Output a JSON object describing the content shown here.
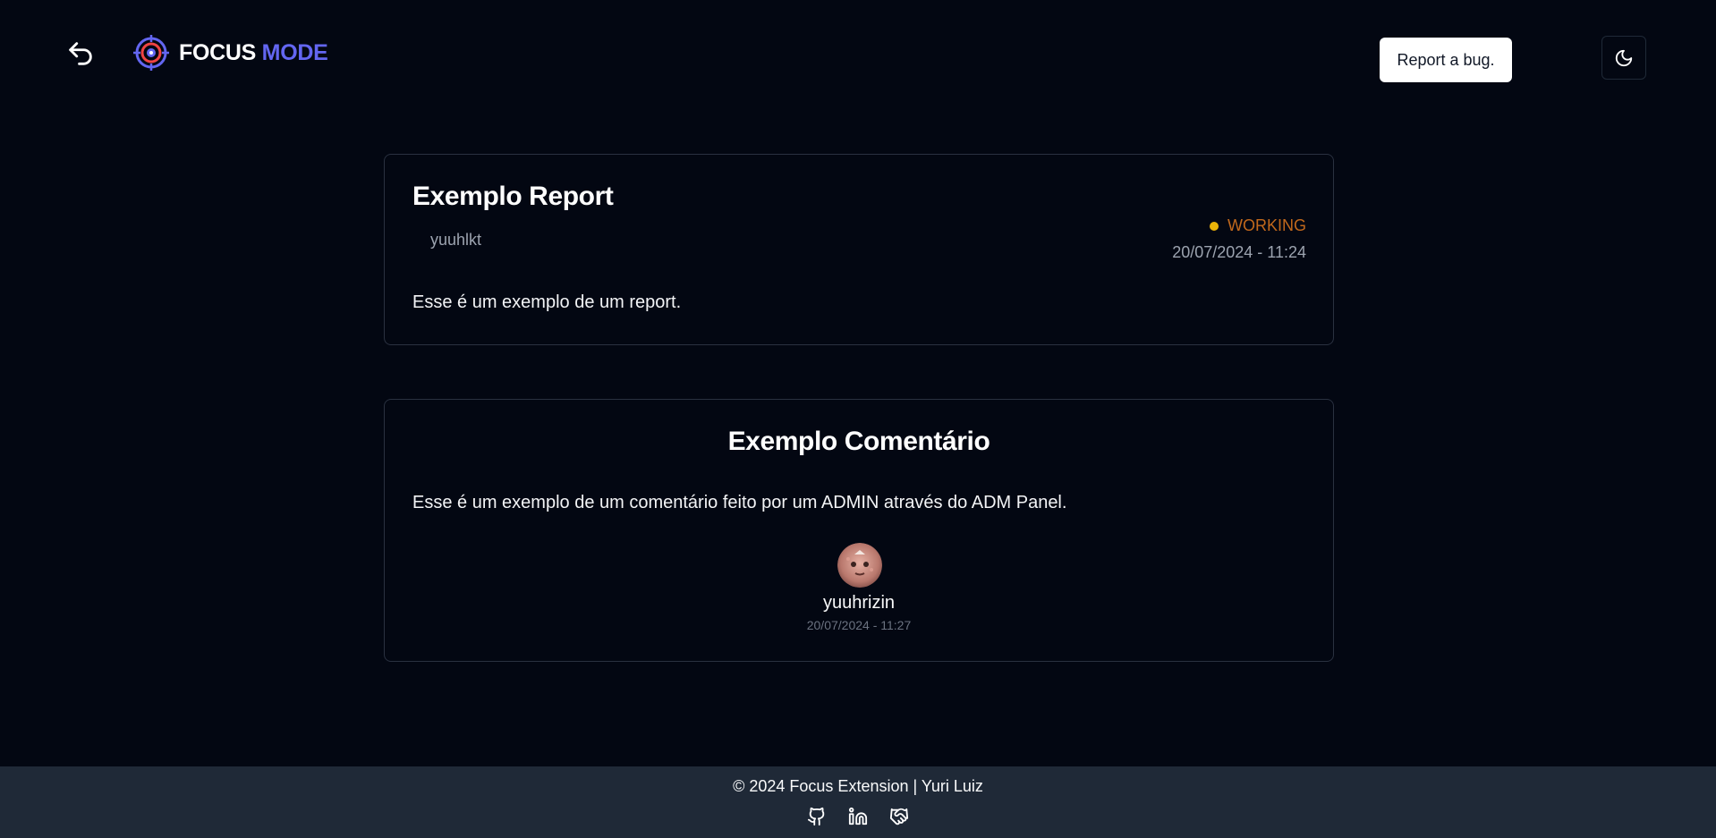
{
  "header": {
    "logo_word1": "FOCUS",
    "logo_word2": "MODE",
    "report_button_label": "Report a bug."
  },
  "report": {
    "title": "Exemplo Report",
    "user": "yuuhlkt",
    "status": "WORKING",
    "status_color": "#eab308",
    "date": "20/07/2024 - 11:24",
    "body": "Esse é um exemplo de um report."
  },
  "comment": {
    "title": "Exemplo Comentário",
    "body": "Esse é um exemplo de um comentário feito por um ADMIN através do ADM Panel.",
    "user": "yuuhrizin",
    "date": "20/07/2024 - 11:27"
  },
  "footer": {
    "text": "© 2024 Focus Extension | Yuri Luiz",
    "icons": [
      "github-icon",
      "linkedin-icon",
      "handshake-icon"
    ]
  },
  "colors": {
    "background": "#030712",
    "accent": "#6366f1",
    "footer_bg": "#1f2937"
  }
}
